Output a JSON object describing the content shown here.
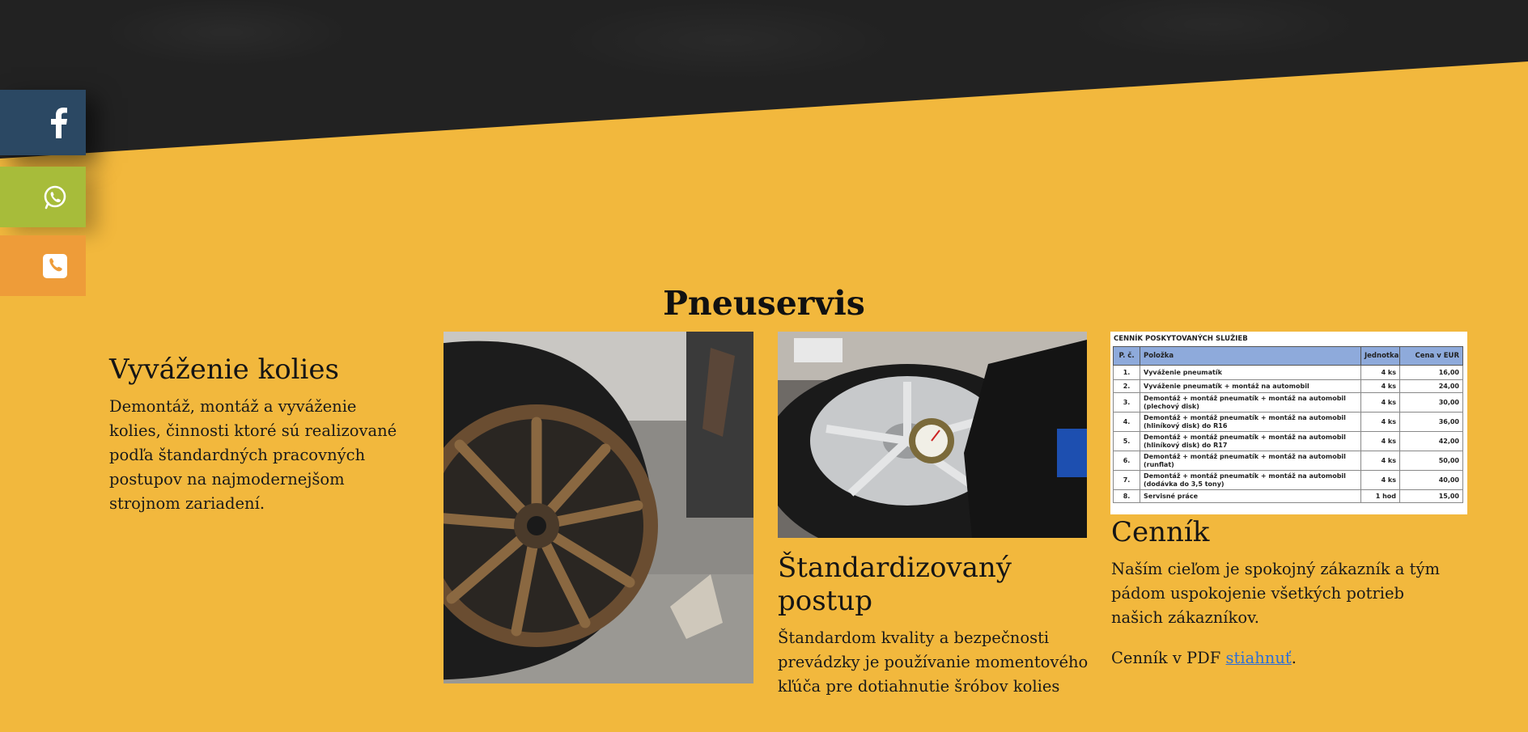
{
  "social": {
    "facebook_icon": "facebook-icon",
    "whatsapp_icon": "whatsapp-icon",
    "phone_icon": "phone-icon",
    "colors": {
      "facebook": "#2B4863",
      "whatsapp": "#A7BC3A",
      "phone": "#EE9C39"
    }
  },
  "section": {
    "title": "Pneuservis",
    "background": "#F2B83D"
  },
  "col1": {
    "heading": "Vyváženie kolies",
    "text": "Demontáž, montáž a vyváženie kolies, činnosti ktoré sú realizované podľa štandardných pracovných postupov na najmodernejšom strojnom zariadení."
  },
  "col2": {
    "heading": "Štandardizovaný postup",
    "text": "Štandardom kvality a bezpečnosti prevádzky je používanie momentového kľúča pre dotiahnutie šróbov kolies"
  },
  "col3": {
    "heading": "Cenník",
    "text": "Naším cieľom je spokojný zákazník a tým pádom uspokojenie všetkých potrieb našich zákazníkov.",
    "pdf_prefix": "Cenník v PDF ",
    "pdf_link": "stiahnuť",
    "pdf_suffix": "."
  },
  "price_list": {
    "title": "CENNÍK POSKYTOVANÝCH SLUŽIEB",
    "headers": [
      "P. č.",
      "Položka",
      "Jednotka",
      "Cena v EUR"
    ],
    "rows": [
      [
        "1.",
        "Vyváženie pneumatík",
        "4 ks",
        "16,00"
      ],
      [
        "2.",
        "Vyváženie pneumatík + montáž na automobil",
        "4 ks",
        "24,00"
      ],
      [
        "3.",
        "Demontáž + montáž pneumatík + montáž na automobil (plechový disk)",
        "4 ks",
        "30,00"
      ],
      [
        "4.",
        "Demontáž + montáž pneumatík + montáž na automobil (hliníkový disk) do R16",
        "4 ks",
        "36,00"
      ],
      [
        "5.",
        "Demontáž + montáž pneumatík + montáž na automobil (hliníkový disk) do R17",
        "4 ks",
        "42,00"
      ],
      [
        "6.",
        "Demontáž + montáž pneumatík + montáž na automobil (runflat)",
        "4 ks",
        "50,00"
      ],
      [
        "7.",
        "Demontáž + montáž pneumatík + montáž na automobil (dodávka do 3,5 tony)",
        "4 ks",
        "40,00"
      ],
      [
        "8.",
        "Servisné práce",
        "1 hod",
        "15,00"
      ]
    ]
  }
}
